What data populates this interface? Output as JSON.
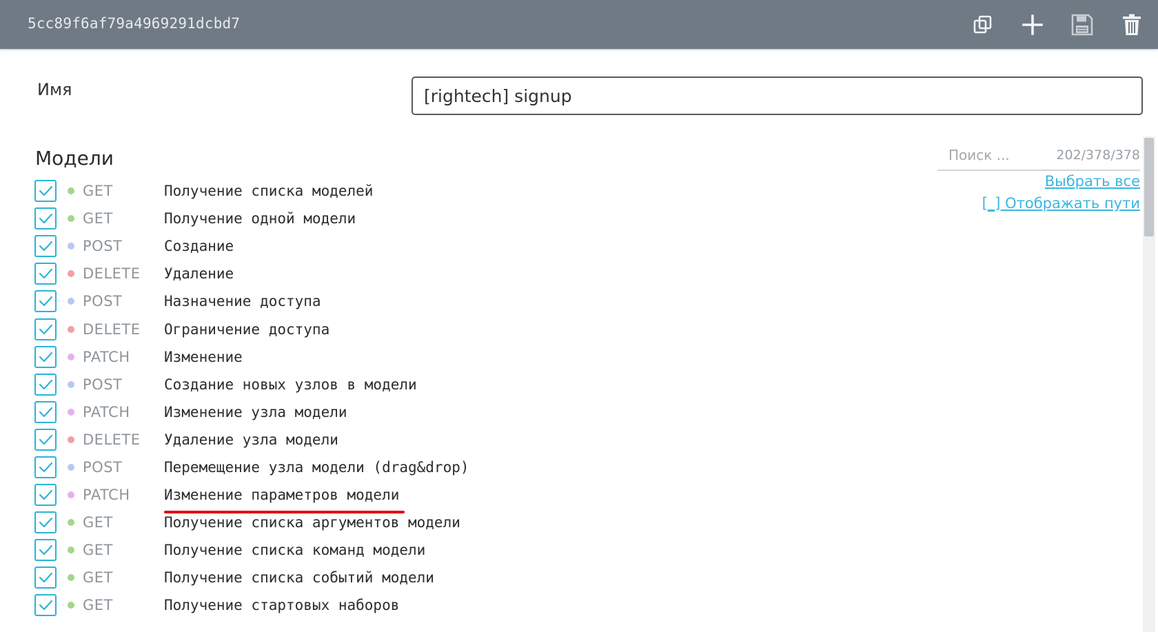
{
  "header": {
    "id": "5cc89f6af79a4969291dcbd7",
    "toolbar": [
      {
        "name": "copy-icon"
      },
      {
        "name": "add-icon"
      },
      {
        "name": "save-icon"
      },
      {
        "name": "delete-icon"
      }
    ]
  },
  "form": {
    "name_label": "Имя",
    "name_value": "[rightech] signup"
  },
  "models": {
    "title": "Модели",
    "search_placeholder": "Поиск ...",
    "count": "202/378/378",
    "select_all": "Выбрать все",
    "show_paths": "[_] Отображать пути",
    "method_colors": {
      "GET": "#a3d68a",
      "POST": "#b9c7f2",
      "DELETE": "#f0a0a0",
      "PATCH": "#e4b1ee"
    },
    "checkbox_color": "#2db3d8",
    "highlight_color": "#e3001b",
    "endpoints": [
      {
        "method": "GET",
        "desc": "Получение списка моделей",
        "checked": true
      },
      {
        "method": "GET",
        "desc": "Получение одной модели",
        "checked": true
      },
      {
        "method": "POST",
        "desc": "Создание",
        "checked": true
      },
      {
        "method": "DELETE",
        "desc": "Удаление",
        "checked": true
      },
      {
        "method": "POST",
        "desc": "Назначение доступа",
        "checked": true
      },
      {
        "method": "DELETE",
        "desc": "Ограничение доступа",
        "checked": true
      },
      {
        "method": "PATCH",
        "desc": "Изменение",
        "checked": true
      },
      {
        "method": "POST",
        "desc": "Создание новых узлов в модели",
        "checked": true
      },
      {
        "method": "PATCH",
        "desc": "Изменение узла модели",
        "checked": true
      },
      {
        "method": "DELETE",
        "desc": "Удаление узла модели",
        "checked": true
      },
      {
        "method": "POST",
        "desc": "Перемещение узла модели (drag&drop)",
        "checked": true
      },
      {
        "method": "PATCH",
        "desc": "Изменение параметров модели",
        "checked": true,
        "underlined": true
      },
      {
        "method": "GET",
        "desc": "Получение списка аргументов модели",
        "checked": true
      },
      {
        "method": "GET",
        "desc": "Получение списка команд модели",
        "checked": true
      },
      {
        "method": "GET",
        "desc": "Получение списка событий модели",
        "checked": true
      },
      {
        "method": "GET",
        "desc": "Получение стартовых наборов",
        "checked": true
      }
    ]
  }
}
